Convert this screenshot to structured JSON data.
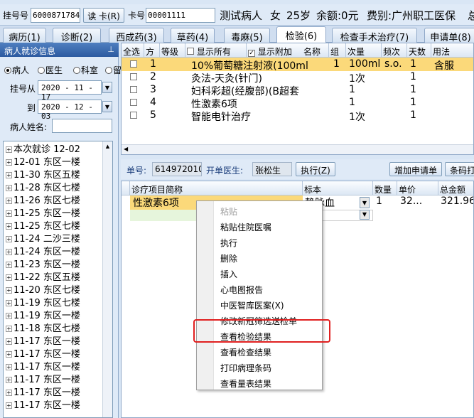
{
  "header": {
    "reg_no_label": "挂号号",
    "reg_no": "60008717841",
    "read_card_button": "读 卡(R)",
    "card_no_label": "卡号",
    "card_no": "00001111",
    "patient_name": "测试病人",
    "gender": "女",
    "age": "25岁",
    "balance": "余额:0元",
    "fee_type": "费别:广州职工医保",
    "overflow_char": "总"
  },
  "tabs": [
    {
      "label": "病历(1)"
    },
    {
      "label": "诊断(2)"
    },
    {
      "label": "西成药(3)"
    },
    {
      "label": "草药(4)"
    },
    {
      "label": "毒麻(5)"
    },
    {
      "label": "检验(6)",
      "active": true
    },
    {
      "label": "检查手术治疗(7)"
    },
    {
      "label": "申请单(8)"
    }
  ],
  "left_panel": {
    "title": "病人就诊信息",
    "pin_icon": "pin-icon",
    "radios": [
      {
        "label": "病人",
        "checked": true
      },
      {
        "label": "医生",
        "checked": false
      },
      {
        "label": "科室",
        "checked": false
      },
      {
        "label": "留",
        "checked": false
      }
    ],
    "date_from_label": "挂号从",
    "date_from": "2020 - 11 - 17",
    "date_to_label": "到",
    "date_to": "2020 - 12 - 03",
    "patient_name_label": "病人姓名:",
    "patient_name_value": "",
    "visits": [
      "本次就诊 12-02",
      "12-01 东区一楼",
      "11-30 东区五楼",
      "11-28 东区七楼",
      "11-26 东区七楼",
      "11-25 东区一楼",
      "11-25 东区七楼",
      "11-24 二沙三楼",
      "11-24 东区一楼",
      "11-23 东区一楼",
      "11-22 东区五楼",
      "11-20 东区七楼",
      "11-19 东区七楼",
      "11-19 东区一楼",
      "11-18 东区七楼",
      "11-17 东区一楼",
      "11-17 东区一楼",
      "11-17 东区一楼",
      "11-17 东区一楼",
      "11-17 东区一楼",
      "11-17 东区一楼"
    ]
  },
  "top_grid": {
    "headers": {
      "select_all": "全选",
      "fang": "方",
      "level": "等级",
      "show_all": "显示所有",
      "show_extra": "显示附加",
      "name": "名称",
      "group": "组",
      "dose": "次量",
      "freq": "频次",
      "days": "天数",
      "usage": "用法"
    },
    "rows": [
      {
        "no": "1",
        "name": "10%葡萄糖注射液(100ml",
        "group": "1",
        "dose": "100ml",
        "freq": "s.o.",
        "days": "1",
        "usage": "含服"
      },
      {
        "no": "2",
        "name": "灸法-天灸(针门)",
        "group": "",
        "dose": "1次",
        "freq": "",
        "days": "1",
        "usage": ""
      },
      {
        "no": "3",
        "name": "妇科彩超(经腹部)(B超套",
        "group": "",
        "dose": "1",
        "freq": "",
        "days": "1",
        "usage": ""
      },
      {
        "no": "4",
        "name": "性激素6项",
        "group": "",
        "dose": "1",
        "freq": "",
        "days": "1",
        "usage": ""
      },
      {
        "no": "5",
        "name": "智能电针治疗",
        "group": "",
        "dose": "1次",
        "freq": "",
        "days": "1",
        "usage": ""
      }
    ]
  },
  "order_bar": {
    "order_no_label": "单号:",
    "order_no": "614972010",
    "doctor_label": "开单医生:",
    "doctor": "张松生",
    "execute_button": "执行(Z)",
    "add_request_button": "增加申请单",
    "barcode_button": "条码打"
  },
  "lower_grid": {
    "headers": {
      "item": "诊疗项目简称",
      "specimen": "标本",
      "qty": "数量",
      "price": "单价",
      "total": "总金额"
    },
    "rows": [
      {
        "item": "性激素6项",
        "specimen": "静脉血",
        "qty": "1",
        "price": "32...",
        "total": "321.96"
      }
    ]
  },
  "context_menu": {
    "items": [
      {
        "label": "粘贴",
        "disabled": true
      },
      {
        "label": "粘贴住院医嘱",
        "disabled": false
      },
      {
        "label": "执行",
        "disabled": false
      },
      {
        "label": "删除",
        "disabled": false
      },
      {
        "label": "插入",
        "disabled": false
      },
      {
        "label": "心电图报告",
        "disabled": false
      },
      {
        "label": "中医智库医案(X)",
        "disabled": false
      },
      {
        "label": "修改新冠筛选送检单",
        "disabled": false
      },
      {
        "label": "查看检验结果",
        "disabled": false,
        "highlighted": true
      },
      {
        "label": "查看检查结果",
        "disabled": false
      },
      {
        "label": "打印病理条码",
        "disabled": false
      },
      {
        "label": "查看量表结果",
        "disabled": false
      }
    ]
  },
  "colors": {
    "selected_row": "#fbd97a",
    "highlight_box": "#e02020",
    "panel_title": "#2c5aa0"
  }
}
